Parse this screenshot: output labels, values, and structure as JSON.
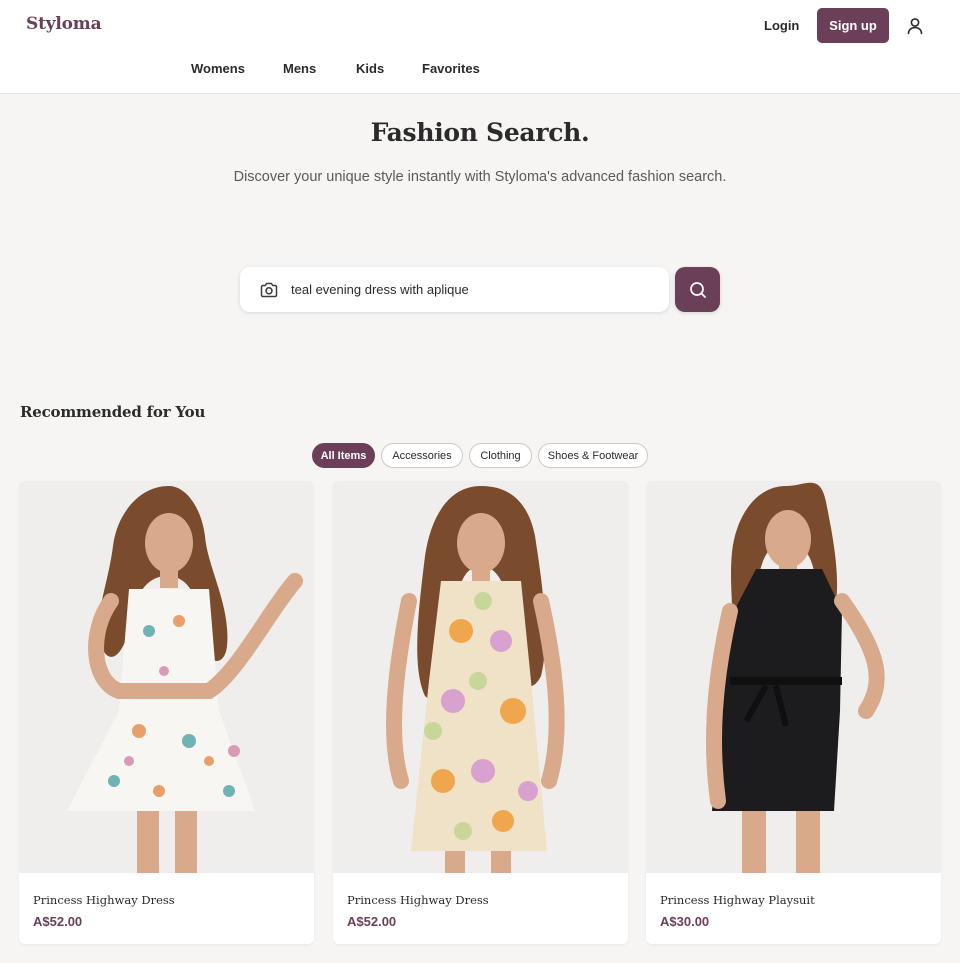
{
  "brand": {
    "logo": "Styloma",
    "accent_color": "#6b3f58"
  },
  "header": {
    "login_label": "Login",
    "signup_label": "Sign up",
    "user_icon": "user-icon",
    "nav": [
      {
        "label": "Womens"
      },
      {
        "label": "Mens"
      },
      {
        "label": "Kids"
      },
      {
        "label": "Favorites"
      }
    ]
  },
  "hero": {
    "title": "Fashion Search.",
    "subtitle": "Discover your unique style instantly with Styloma's advanced fashion search."
  },
  "search": {
    "value": "teal evening dress with aplique",
    "camera_icon": "camera-icon",
    "button_icon": "search-icon"
  },
  "recommended": {
    "title": "Recommended for You",
    "filters": [
      {
        "label": "All Items",
        "active": true
      },
      {
        "label": "Accessories",
        "active": false
      },
      {
        "label": "Clothing",
        "active": false
      },
      {
        "label": "Shoes & Footwear",
        "active": false
      }
    ],
    "products": [
      {
        "name": "Princess Highway Dress",
        "price": "A$52.00"
      },
      {
        "name": "Princess Highway Dress",
        "price": "A$52.00"
      },
      {
        "name": "Princess Highway Playsuit",
        "price": "A$30.00"
      }
    ]
  }
}
